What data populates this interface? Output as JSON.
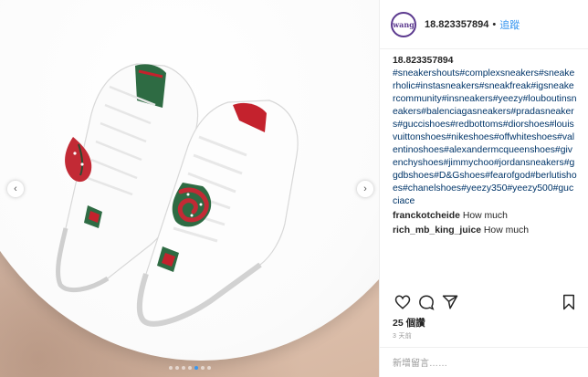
{
  "post": {
    "username": "18.823357894",
    "avatar_text": "wang",
    "follow_label": "追蹤",
    "separator": "•",
    "caption_user": "18.823357894",
    "caption": "#sneakershouts#complexsneakers#sneakerholic#instasneakers#sneakfreak#igsneakercommunity#insneakers#yeezy#louboutinsneakers#balenciagasneakers#pradasneakers#guccishoes#redbottoms#diorshoes#louisvuittonshoes#nikeshoes#offwhiteshoes#valentinoshoes#alexandermcqueenshoes#givenchyshoes#jimmychoo#jordansneakers#ggdbshoes#D&Gshoes#fearofgod#berlutishoes#chanelshoes#yeezy350#yeezy500#gucciace",
    "comments": [
      {
        "user": "franckotcheide",
        "text": "How much"
      },
      {
        "user": "rich_mb_king_juice",
        "text": "How much"
      }
    ],
    "likes": "25 個讚",
    "time": "3 天前",
    "add_comment_placeholder": "新增留言……"
  },
  "icons": {
    "like": "heart-icon",
    "comment": "comment-icon",
    "share": "share-icon",
    "save": "bookmark-icon",
    "prev": "chevron-left-icon",
    "next": "chevron-right-icon"
  },
  "carousel": {
    "total": 7,
    "active": 5
  },
  "colors": {
    "link": "#3897f0",
    "hashtag": "#003569",
    "avatar_ring": "#5c3a8f"
  }
}
